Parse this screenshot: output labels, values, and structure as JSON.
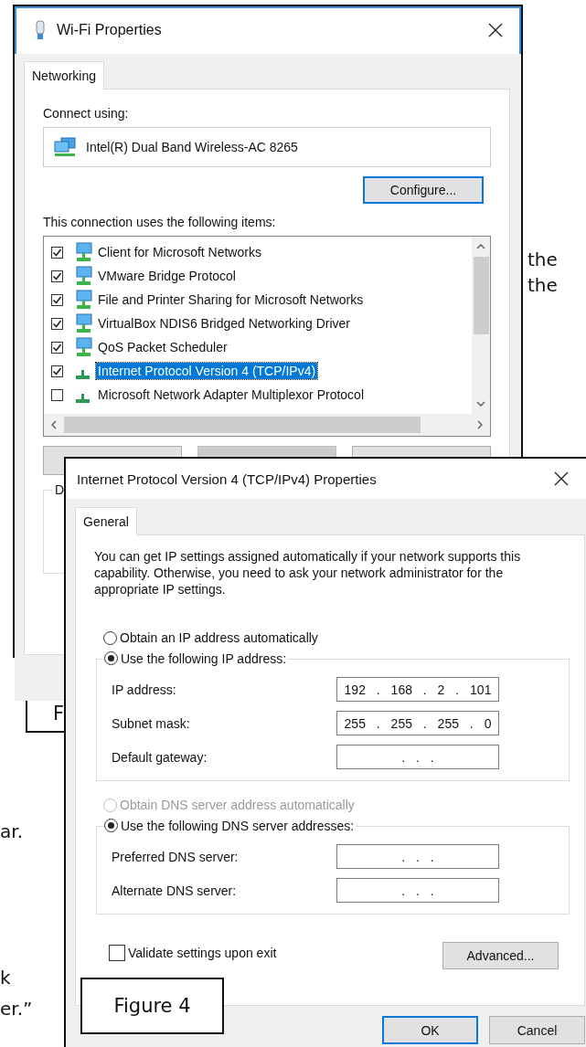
{
  "background_document": {
    "fragments": [
      {
        "text": "the"
      },
      {
        "text": "the"
      },
      {
        "text": "ar."
      },
      {
        "text": "k"
      },
      {
        "text": "er.”"
      }
    ],
    "captions": [
      {
        "text": "F"
      },
      {
        "text": "Figure 4"
      }
    ]
  },
  "wifi_dialog": {
    "title": "Wi-Fi Properties",
    "tabs": [
      {
        "label": "Networking",
        "selected": true
      }
    ],
    "connect_label": "Connect using:",
    "adapter": "Intel(R) Dual Band Wireless-AC 8265",
    "configure_button": "Configure...",
    "items_label": "This connection uses the following items:",
    "items": [
      {
        "label": "Client for Microsoft Networks",
        "kind": "service",
        "checked": true,
        "selected": false
      },
      {
        "label": "VMware Bridge Protocol",
        "kind": "service",
        "checked": true,
        "selected": false
      },
      {
        "label": "File and Printer Sharing for Microsoft Networks",
        "kind": "service",
        "checked": true,
        "selected": false
      },
      {
        "label": "VirtualBox NDIS6 Bridged Networking Driver",
        "kind": "service",
        "checked": true,
        "selected": false
      },
      {
        "label": "QoS Packet Scheduler",
        "kind": "service",
        "checked": true,
        "selected": false
      },
      {
        "label": "Internet Protocol Version 4 (TCP/IPv4)",
        "kind": "protocol",
        "checked": true,
        "selected": true
      },
      {
        "label": "Microsoft Network Adapter Multiplexor Protocol",
        "kind": "protocol",
        "checked": false,
        "selected": false
      }
    ],
    "group_label": "D"
  },
  "ipv4_dialog": {
    "title": "Internet Protocol Version 4 (TCP/IPv4) Properties",
    "tabs": [
      {
        "label": "General",
        "selected": true
      }
    ],
    "description": "You can get IP settings assigned automatically if your network supports this capability. Otherwise, you need to ask your network administrator for the appropriate IP settings.",
    "ip_options": [
      {
        "label": "Obtain an IP address automatically",
        "selected": false,
        "disabled": false
      },
      {
        "label": "Use the following IP address:",
        "selected": true,
        "disabled": false
      }
    ],
    "ip_fields": [
      {
        "label": "IP address:",
        "value": "192 . 168 . 2 . 101"
      },
      {
        "label": "Subnet mask:",
        "value": "255 . 255 . 255 . 0"
      },
      {
        "label": "Default gateway:",
        "value": ". . ."
      }
    ],
    "dns_options": [
      {
        "label": "Obtain DNS server address automatically",
        "selected": false,
        "disabled": true
      },
      {
        "label": "Use the following DNS server addresses:",
        "selected": true,
        "disabled": false
      }
    ],
    "dns_fields": [
      {
        "label": "Preferred DNS server:",
        "value": ". . ."
      },
      {
        "label": "Alternate DNS server:",
        "value": ". . ."
      }
    ],
    "validate": {
      "label": "Validate settings upon exit",
      "checked": false
    },
    "advanced_button": "Advanced...",
    "buttons": [
      {
        "label": "OK",
        "default": true
      },
      {
        "label": "Cancel",
        "default": false
      }
    ]
  }
}
